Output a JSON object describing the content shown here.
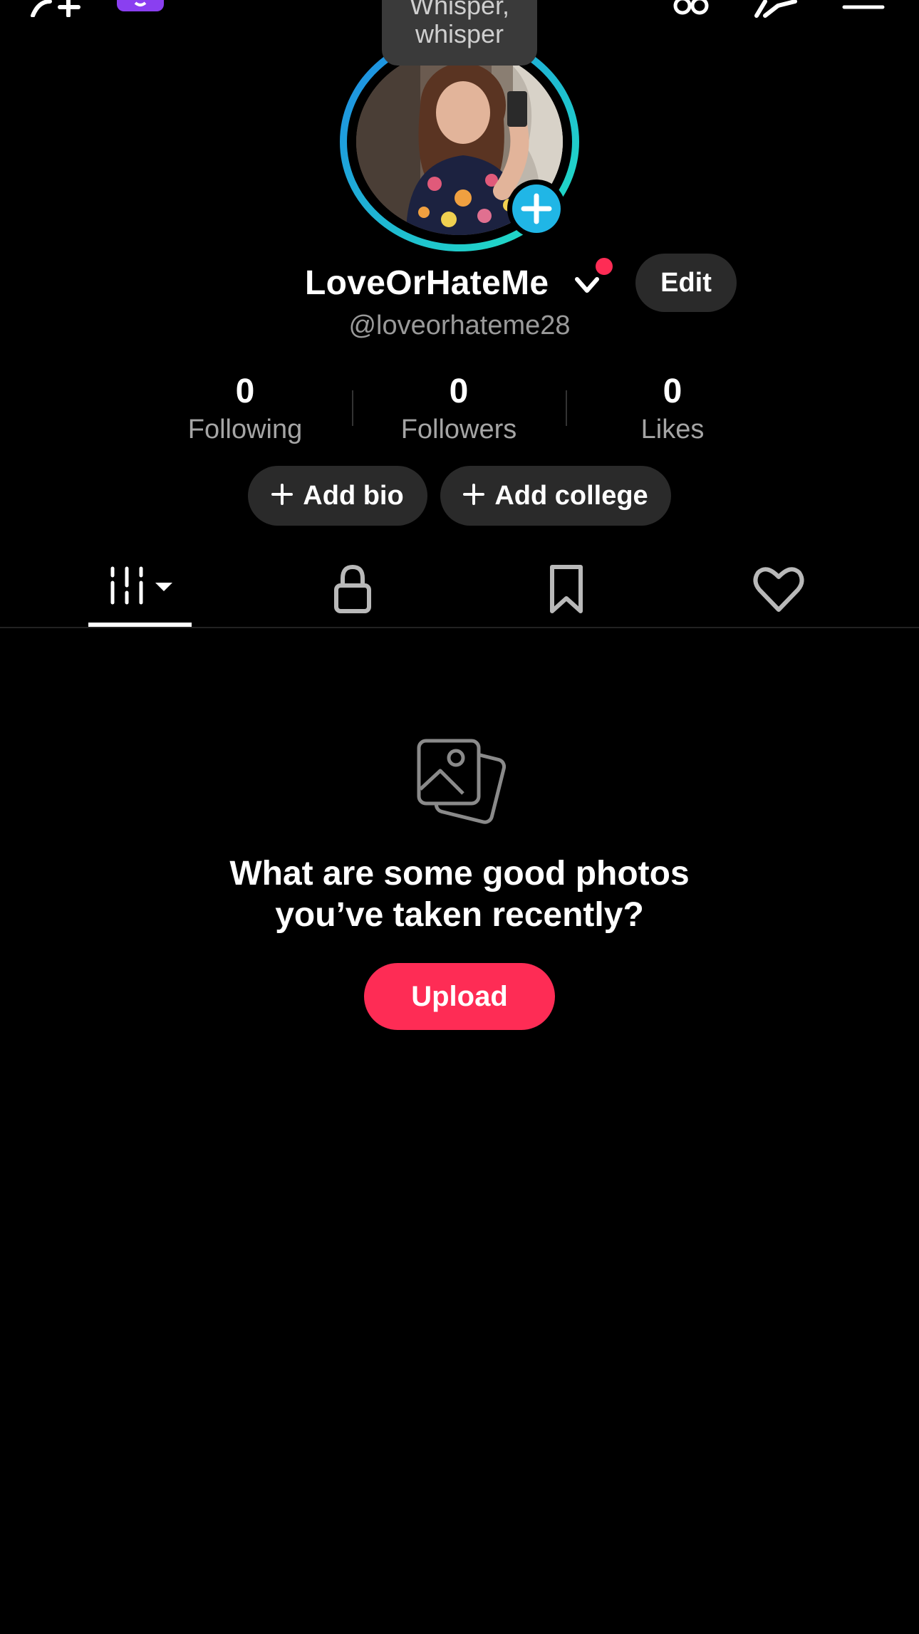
{
  "top_bar": {
    "icons": [
      "add-friend-icon",
      "app-badge-icon",
      "music-icon",
      "trending-icon",
      "menu-icon"
    ]
  },
  "profile": {
    "bubble_line1": "Whisper,",
    "bubble_line2": "whisper",
    "display_name": "LoveOrHateMe",
    "edit_label": "Edit",
    "handle": "@loveorhateme28"
  },
  "stats": [
    {
      "value": "0",
      "label": "Following"
    },
    {
      "value": "0",
      "label": "Followers"
    },
    {
      "value": "0",
      "label": "Likes"
    }
  ],
  "actions": {
    "add_bio": "Add bio",
    "add_college": "Add college"
  },
  "tabs": [
    "posts-grid-icon",
    "lock-icon",
    "bookmark-icon",
    "heart-icon"
  ],
  "empty_state": {
    "line1": "What are some good photos",
    "line2": "you’ve taken recently?",
    "upload_label": "Upload"
  },
  "colors": {
    "accent": "#fe2c55",
    "plus_blue": "#20b6e6",
    "ring_start": "#1e88e5",
    "ring_end": "#20e3c2"
  }
}
